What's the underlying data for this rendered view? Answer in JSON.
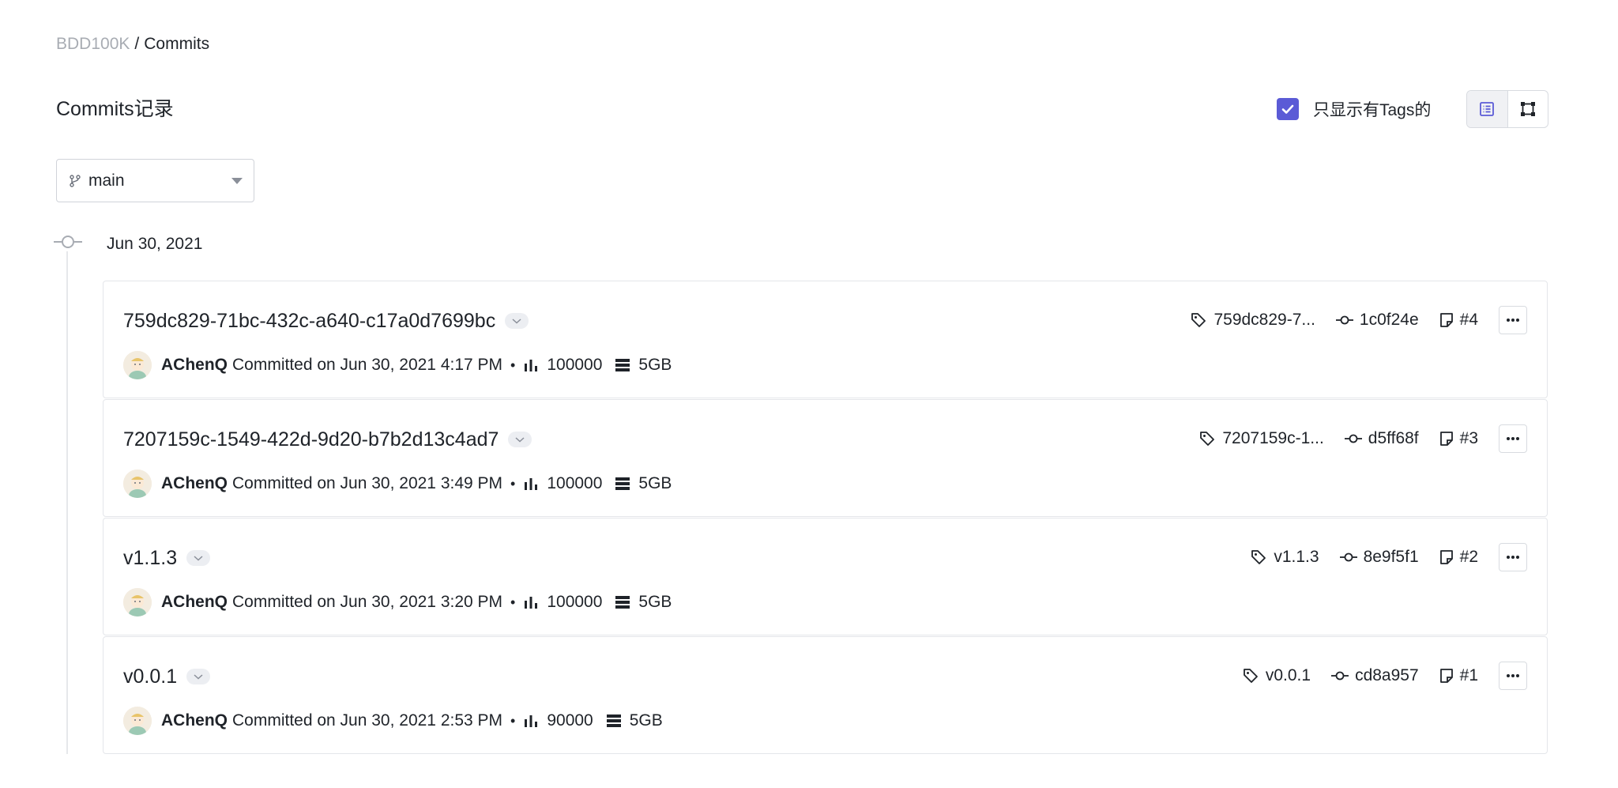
{
  "breadcrumb": {
    "root": "BDD100K",
    "separator": "/",
    "current": "Commits"
  },
  "page": {
    "title": "Commits记录"
  },
  "filters": {
    "tags_only_label": "只显示有Tags的",
    "tags_only_checked": true,
    "view_modes": [
      "list-icon",
      "graph-icon"
    ],
    "active_view": "list"
  },
  "branch": {
    "selected": "main"
  },
  "timeline": {
    "date": "Jun 30, 2021"
  },
  "colors": {
    "accent": "#5b5bd6",
    "muted_text": "#a8acb3",
    "border": "#e4e6ea"
  },
  "commits": [
    {
      "title": "759dc829-71bc-432c-a640-c17a0d7699bc",
      "author": "AChenQ",
      "committed_text": "Committed on Jun 30, 2021 4:17 PM",
      "count": "100000",
      "size": "5GB",
      "tag": "759dc829-7...",
      "hash": "1c0f24e",
      "number": "#4"
    },
    {
      "title": "7207159c-1549-422d-9d20-b7b2d13c4ad7",
      "author": "AChenQ",
      "committed_text": "Committed on Jun 30, 2021 3:49 PM",
      "count": "100000",
      "size": "5GB",
      "tag": "7207159c-1...",
      "hash": "d5ff68f",
      "number": "#3"
    },
    {
      "title": "v1.1.3",
      "author": "AChenQ",
      "committed_text": "Committed on Jun 30, 2021 3:20 PM",
      "count": "100000",
      "size": "5GB",
      "tag": "v1.1.3",
      "hash": "8e9f5f1",
      "number": "#2"
    },
    {
      "title": "v0.0.1",
      "author": "AChenQ",
      "committed_text": "Committed on Jun 30, 2021 2:53 PM",
      "count": "90000",
      "size": "5GB",
      "tag": "v0.0.1",
      "hash": "cd8a957",
      "number": "#1"
    }
  ]
}
